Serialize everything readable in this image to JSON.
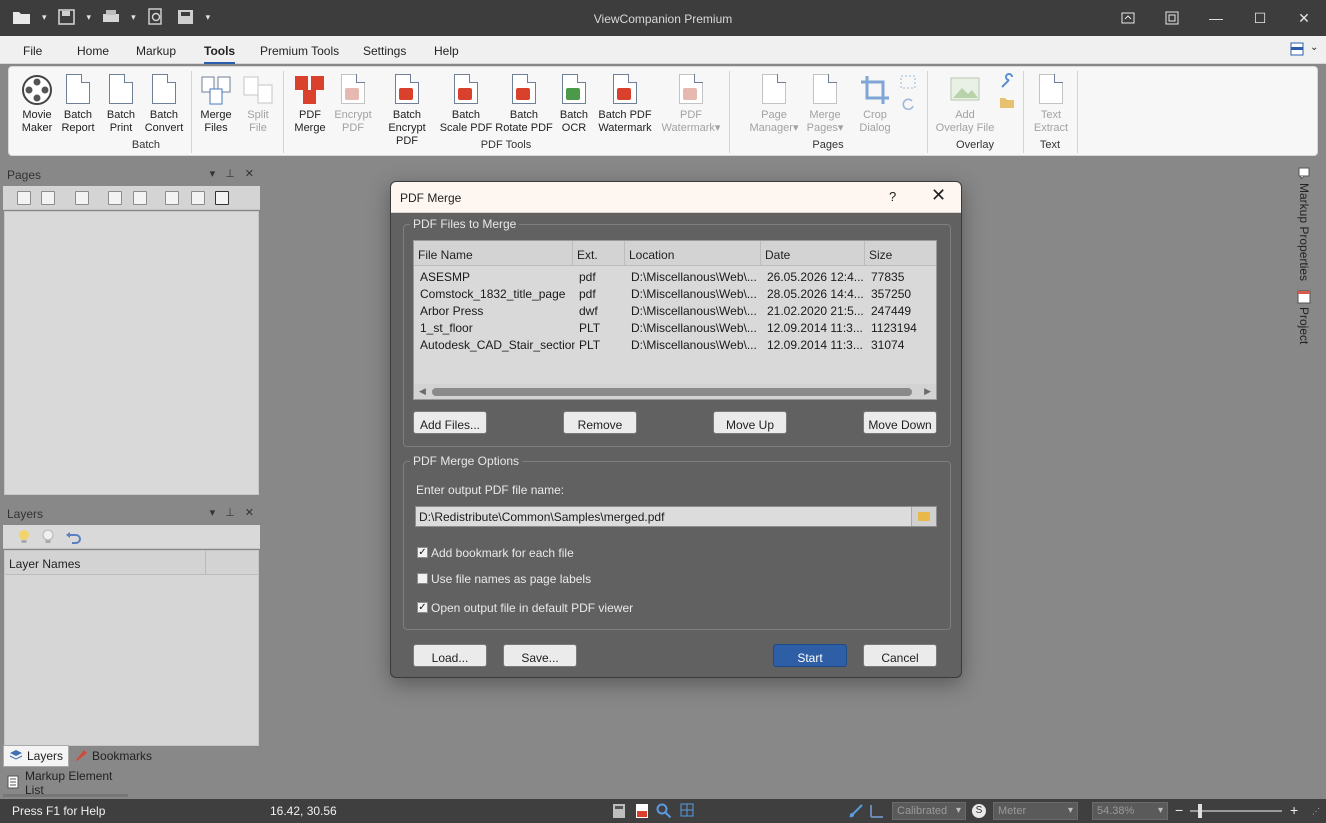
{
  "window": {
    "title": "ViewCompanion Premium"
  },
  "menu": {
    "tabs": [
      "File",
      "Home",
      "Markup",
      "Tools",
      "Premium Tools",
      "Settings",
      "Help"
    ],
    "active": "Tools"
  },
  "ribbon": {
    "buttons": [
      {
        "l1": "Movie",
        "l2": "Maker",
        "icon": "film-reel-icon"
      },
      {
        "l1": "Batch",
        "l2": "Report",
        "icon": "batch-report-icon"
      },
      {
        "l1": "Batch",
        "l2": "Print",
        "icon": "batch-print-icon"
      },
      {
        "l1": "Batch",
        "l2": "Convert",
        "icon": "batch-convert-icon"
      },
      {
        "l1": "Merge",
        "l2": "Files",
        "icon": "merge-files-icon"
      },
      {
        "l1": "Split",
        "l2": "File",
        "icon": "split-file-icon"
      },
      {
        "l1": "PDF",
        "l2": "Merge",
        "icon": "pdf-merge-icon"
      },
      {
        "l1": "Encrypt",
        "l2": "PDF",
        "icon": "encrypt-pdf-icon"
      },
      {
        "l1": "Batch",
        "l2": "Encrypt PDF",
        "icon": "batch-encrypt-pdf-icon"
      },
      {
        "l1": "Batch",
        "l2": "Scale PDF",
        "icon": "batch-scale-pdf-icon"
      },
      {
        "l1": "Batch",
        "l2": "Rotate PDF",
        "icon": "batch-rotate-pdf-icon"
      },
      {
        "l1": "Batch",
        "l2": "OCR",
        "icon": "batch-ocr-icon"
      },
      {
        "l1": "Batch PDF",
        "l2": "Watermark",
        "icon": "batch-pdf-watermark-icon"
      },
      {
        "l1": "PDF",
        "l2": "Watermark",
        "icon": "pdf-watermark-icon"
      },
      {
        "l1": "Page",
        "l2": "Manager",
        "icon": "page-manager-icon"
      },
      {
        "l1": "Merge",
        "l2": "Pages",
        "icon": "merge-pages-icon"
      },
      {
        "l1": "Crop",
        "l2": "Dialog",
        "icon": "crop-icon"
      },
      {
        "l1": "Add",
        "l2": "Overlay File",
        "icon": "add-overlay-icon"
      },
      {
        "l1": "Text",
        "l2": "Extract",
        "icon": "text-extract-icon"
      }
    ],
    "groups": [
      "Batch",
      "PDF Tools",
      "Pages",
      "Overlay",
      "Text"
    ]
  },
  "panes": {
    "pages": {
      "title": "Pages"
    },
    "layers": {
      "title": "Layers",
      "column": "Layer Names"
    },
    "tabs": [
      "Layers",
      "Bookmarks"
    ],
    "markup_list": "Markup Element List"
  },
  "right_strip": {
    "markup_properties": "Markup Properties",
    "project": "Project"
  },
  "dialog": {
    "title": "PDF Merge",
    "help": "?",
    "close": "✕",
    "files_group": "PDF Files to Merge",
    "columns": [
      "File Name",
      "Ext.",
      "Location",
      "Date",
      "Size"
    ],
    "rows": [
      [
        "ASESMP",
        "pdf",
        "D:\\Miscellanous\\Web\\...",
        "26.05.2026 12:4...",
        "77835"
      ],
      [
        "Comstock_1832_title_page",
        "pdf",
        "D:\\Miscellanous\\Web\\...",
        "28.05.2026 14:4...",
        "357250"
      ],
      [
        "Arbor Press",
        "dwf",
        "D:\\Miscellanous\\Web\\...",
        "21.02.2020 21:5...",
        "247449"
      ],
      [
        "1_st_floor",
        "PLT",
        "D:\\Miscellanous\\Web\\...",
        "12.09.2014 11:3...",
        "1123194"
      ],
      [
        "Autodesk_CAD_Stair_section",
        "PLT",
        "D:\\Miscellanous\\Web\\...",
        "12.09.2014 11:3...",
        "31074"
      ]
    ],
    "buttons": {
      "add": "Add Files...",
      "remove": "Remove",
      "move_up": "Move Up",
      "move_down": "Move Down",
      "load": "Load...",
      "save": "Save...",
      "start": "Start",
      "cancel": "Cancel"
    },
    "options_group": "PDF Merge Options",
    "output_label": "Enter output PDF file name:",
    "output_value": "D:\\Redistribute\\Common\\Samples\\merged.pdf",
    "checks": [
      {
        "label": "Add bookmark for each file",
        "checked": true
      },
      {
        "label": "Use file names as page labels",
        "checked": false
      },
      {
        "label": "Open output file in default PDF viewer",
        "checked": true
      }
    ]
  },
  "status": {
    "help": "Press F1 for Help",
    "coords": "16.42, 30.56",
    "calibration": "Calibrated",
    "unit": "Meter",
    "zoom": "54.38%",
    "zoom_minus": "−",
    "zoom_plus": "+"
  }
}
